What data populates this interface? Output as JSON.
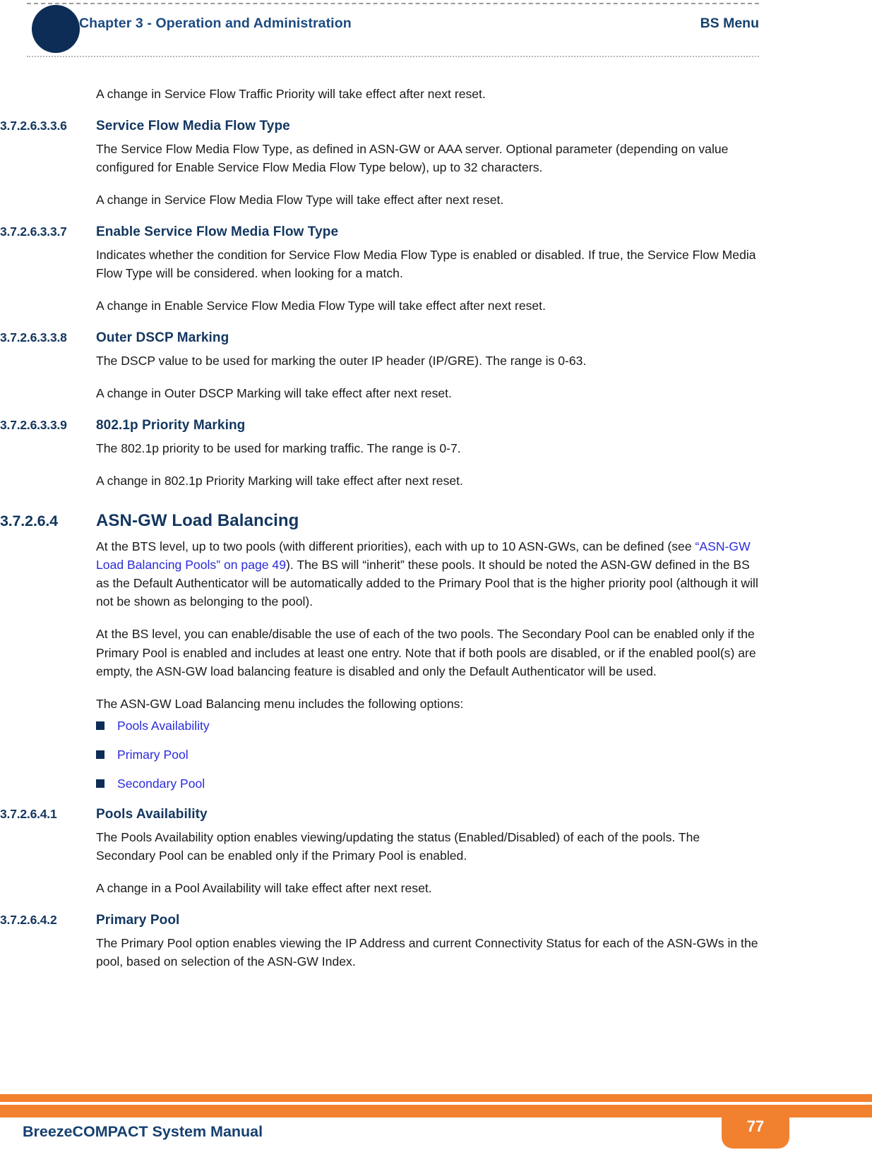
{
  "header": {
    "chapter_title": "Chapter 3 - Operation and Administration",
    "section_label": "BS Menu",
    "dot_icon": "header-bullet-circle"
  },
  "body": {
    "intro_note": "A change in Service Flow Traffic Priority will take effect after next reset.",
    "sections": [
      {
        "number": "3.7.2.6.3.3.6",
        "title": "Service Flow Media Flow Type",
        "paragraphs": [
          "The Service Flow Media Flow Type, as defined in ASN-GW or AAA server. Optional parameter (depending on value configured for Enable Service Flow Media Flow Type below), up to 32 characters.",
          "A change in Service Flow Media Flow Type will take effect after next reset."
        ]
      },
      {
        "number": "3.7.2.6.3.3.7",
        "title": "Enable Service Flow Media Flow Type",
        "paragraphs": [
          "Indicates whether the condition for Service Flow Media Flow Type is enabled or disabled. If true, the Service Flow Media Flow Type will be considered. when looking for a match.",
          "A change in Enable Service Flow Media Flow Type will take effect after next reset."
        ]
      },
      {
        "number": "3.7.2.6.3.3.8",
        "title": "Outer DSCP Marking",
        "paragraphs": [
          "The DSCP value to be used for marking the outer IP header (IP/GRE). The range is 0-63.",
          "A change in Outer DSCP Marking will take effect after next reset."
        ]
      },
      {
        "number": "3.7.2.6.3.3.9",
        "title": "802.1p Priority Marking",
        "paragraphs": [
          "The 802.1p priority to be used for marking traffic. The range is 0-7.",
          "A change in 802.1p Priority Marking will take effect after next reset."
        ]
      }
    ],
    "asn_section": {
      "number": "3.7.2.6.4",
      "title": "ASN-GW Load Balancing",
      "para1_before_link": "At the BTS level, up to two pools (with different priorities), each with up to 10 ASN-GWs, can be defined (see ",
      "para1_link": "“ASN-GW Load Balancing Pools” on page 49",
      "para1_after_link": "). The BS will “inherit” these pools. It should be noted the ASN-GW defined in the BS as the Default Authenticator will be automatically added to the Primary Pool that is the higher priority pool (although it will not be shown as belonging to the pool).",
      "para2": "At the BS level, you can enable/disable the use of each of the two pools. The Secondary Pool can be enabled only if the Primary Pool is enabled and includes at least one entry. Note that if both pools are disabled, or if the enabled pool(s) are empty, the ASN-GW load balancing feature is disabled and only the Default Authenticator will be used.",
      "para3": "The ASN-GW Load Balancing menu includes the following options:",
      "bullets": [
        "Pools Availability",
        "Primary Pool",
        "Secondary Pool"
      ]
    },
    "sub_sections": [
      {
        "number": "3.7.2.6.4.1",
        "title": "Pools Availability",
        "paragraphs": [
          "The Pools Availability option enables viewing/updating the status (Enabled/Disabled) of each of the pools. The Secondary Pool can be enabled only if the Primary Pool is enabled.",
          "A change in a Pool Availability will take effect after next reset."
        ]
      },
      {
        "number": "3.7.2.6.4.2",
        "title": "Primary Pool",
        "paragraphs": [
          "The Primary Pool option enables viewing the IP Address and current Connectivity Status for each of the ASN-GWs in the pool, based on selection of the ASN-GW Index."
        ]
      }
    ]
  },
  "footer": {
    "manual_title": "BreezeCOMPACT System Manual",
    "page_number": "77"
  },
  "colors": {
    "heading_navy": "#13365f",
    "header_blue": "#1c4a80",
    "link_blue": "#2b2bdc",
    "accent_orange": "#f1812f",
    "bullet_navy": "#0d2d56"
  }
}
